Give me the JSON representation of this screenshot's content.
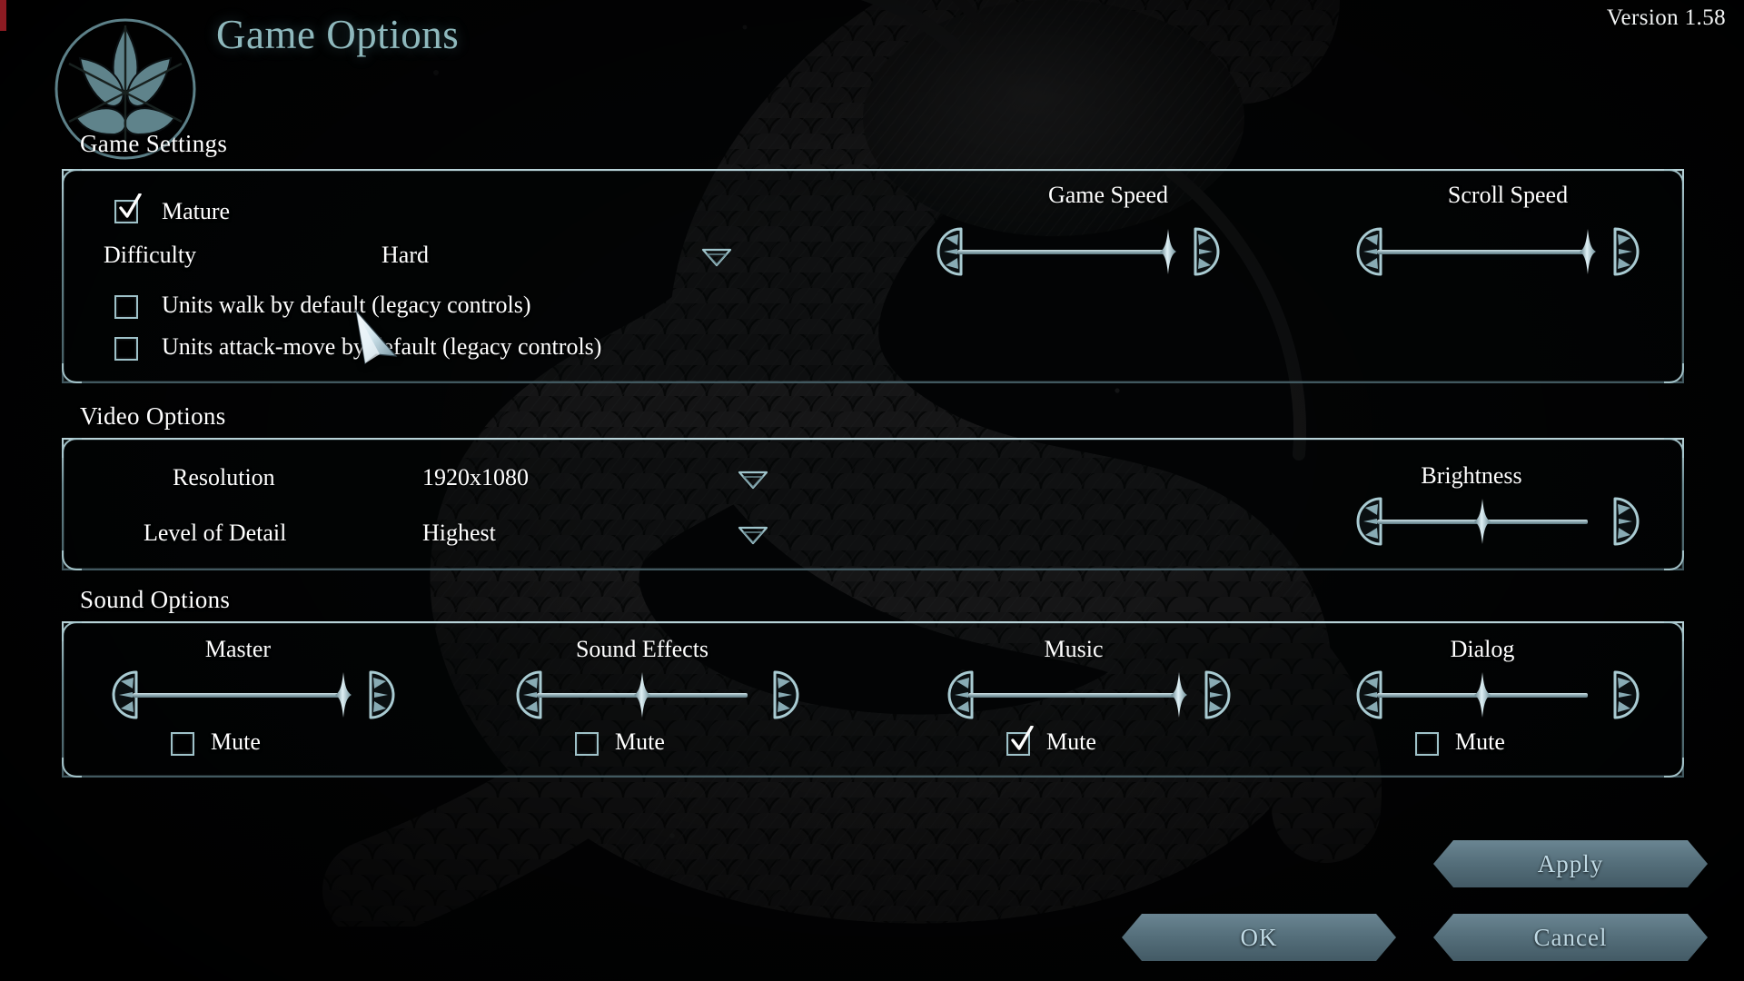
{
  "header": {
    "title": "Game Options",
    "version": "Version 1.58",
    "emblem_icon": "iris-crest-icon"
  },
  "sections": {
    "game_settings": {
      "heading": "Game Settings",
      "mature": {
        "label": "Mature",
        "checked": true
      },
      "difficulty": {
        "label": "Difficulty",
        "value": "Hard",
        "dropdown_icon": "chevron-down-icon"
      },
      "units_walk": {
        "label": "Units walk by default (legacy controls)",
        "checked": false
      },
      "units_attack_move": {
        "label": "Units attack-move by default (legacy controls)",
        "checked": false
      },
      "game_speed": {
        "label": "Game Speed",
        "value": 100
      },
      "scroll_speed": {
        "label": "Scroll Speed",
        "value": 100
      }
    },
    "video_options": {
      "heading": "Video Options",
      "resolution": {
        "label": "Resolution",
        "value": "1920x1080",
        "dropdown_icon": "chevron-down-icon"
      },
      "level_of_detail": {
        "label": "Level of Detail",
        "value": "Highest",
        "dropdown_icon": "chevron-down-icon"
      },
      "brightness": {
        "label": "Brightness",
        "value": 50
      }
    },
    "sound_options": {
      "heading": "Sound Options",
      "mute_label": "Mute",
      "channels": [
        {
          "label": "Master",
          "value": 100,
          "muted": false
        },
        {
          "label": "Sound Effects",
          "value": 50,
          "muted": false
        },
        {
          "label": "Music",
          "value": 100,
          "muted": true
        },
        {
          "label": "Dialog",
          "value": 50,
          "muted": false
        }
      ]
    }
  },
  "buttons": {
    "apply": "Apply",
    "ok": "OK",
    "cancel": "Cancel"
  },
  "colors": {
    "accent": "#8fb9bd",
    "text": "#ffffff",
    "button_text": "#bfd9e4",
    "frame": "#a8c8ce",
    "background": "#030405",
    "red_sliver": "#8c1b22"
  },
  "cursor": {
    "icon": "arrow-cursor-icon"
  }
}
